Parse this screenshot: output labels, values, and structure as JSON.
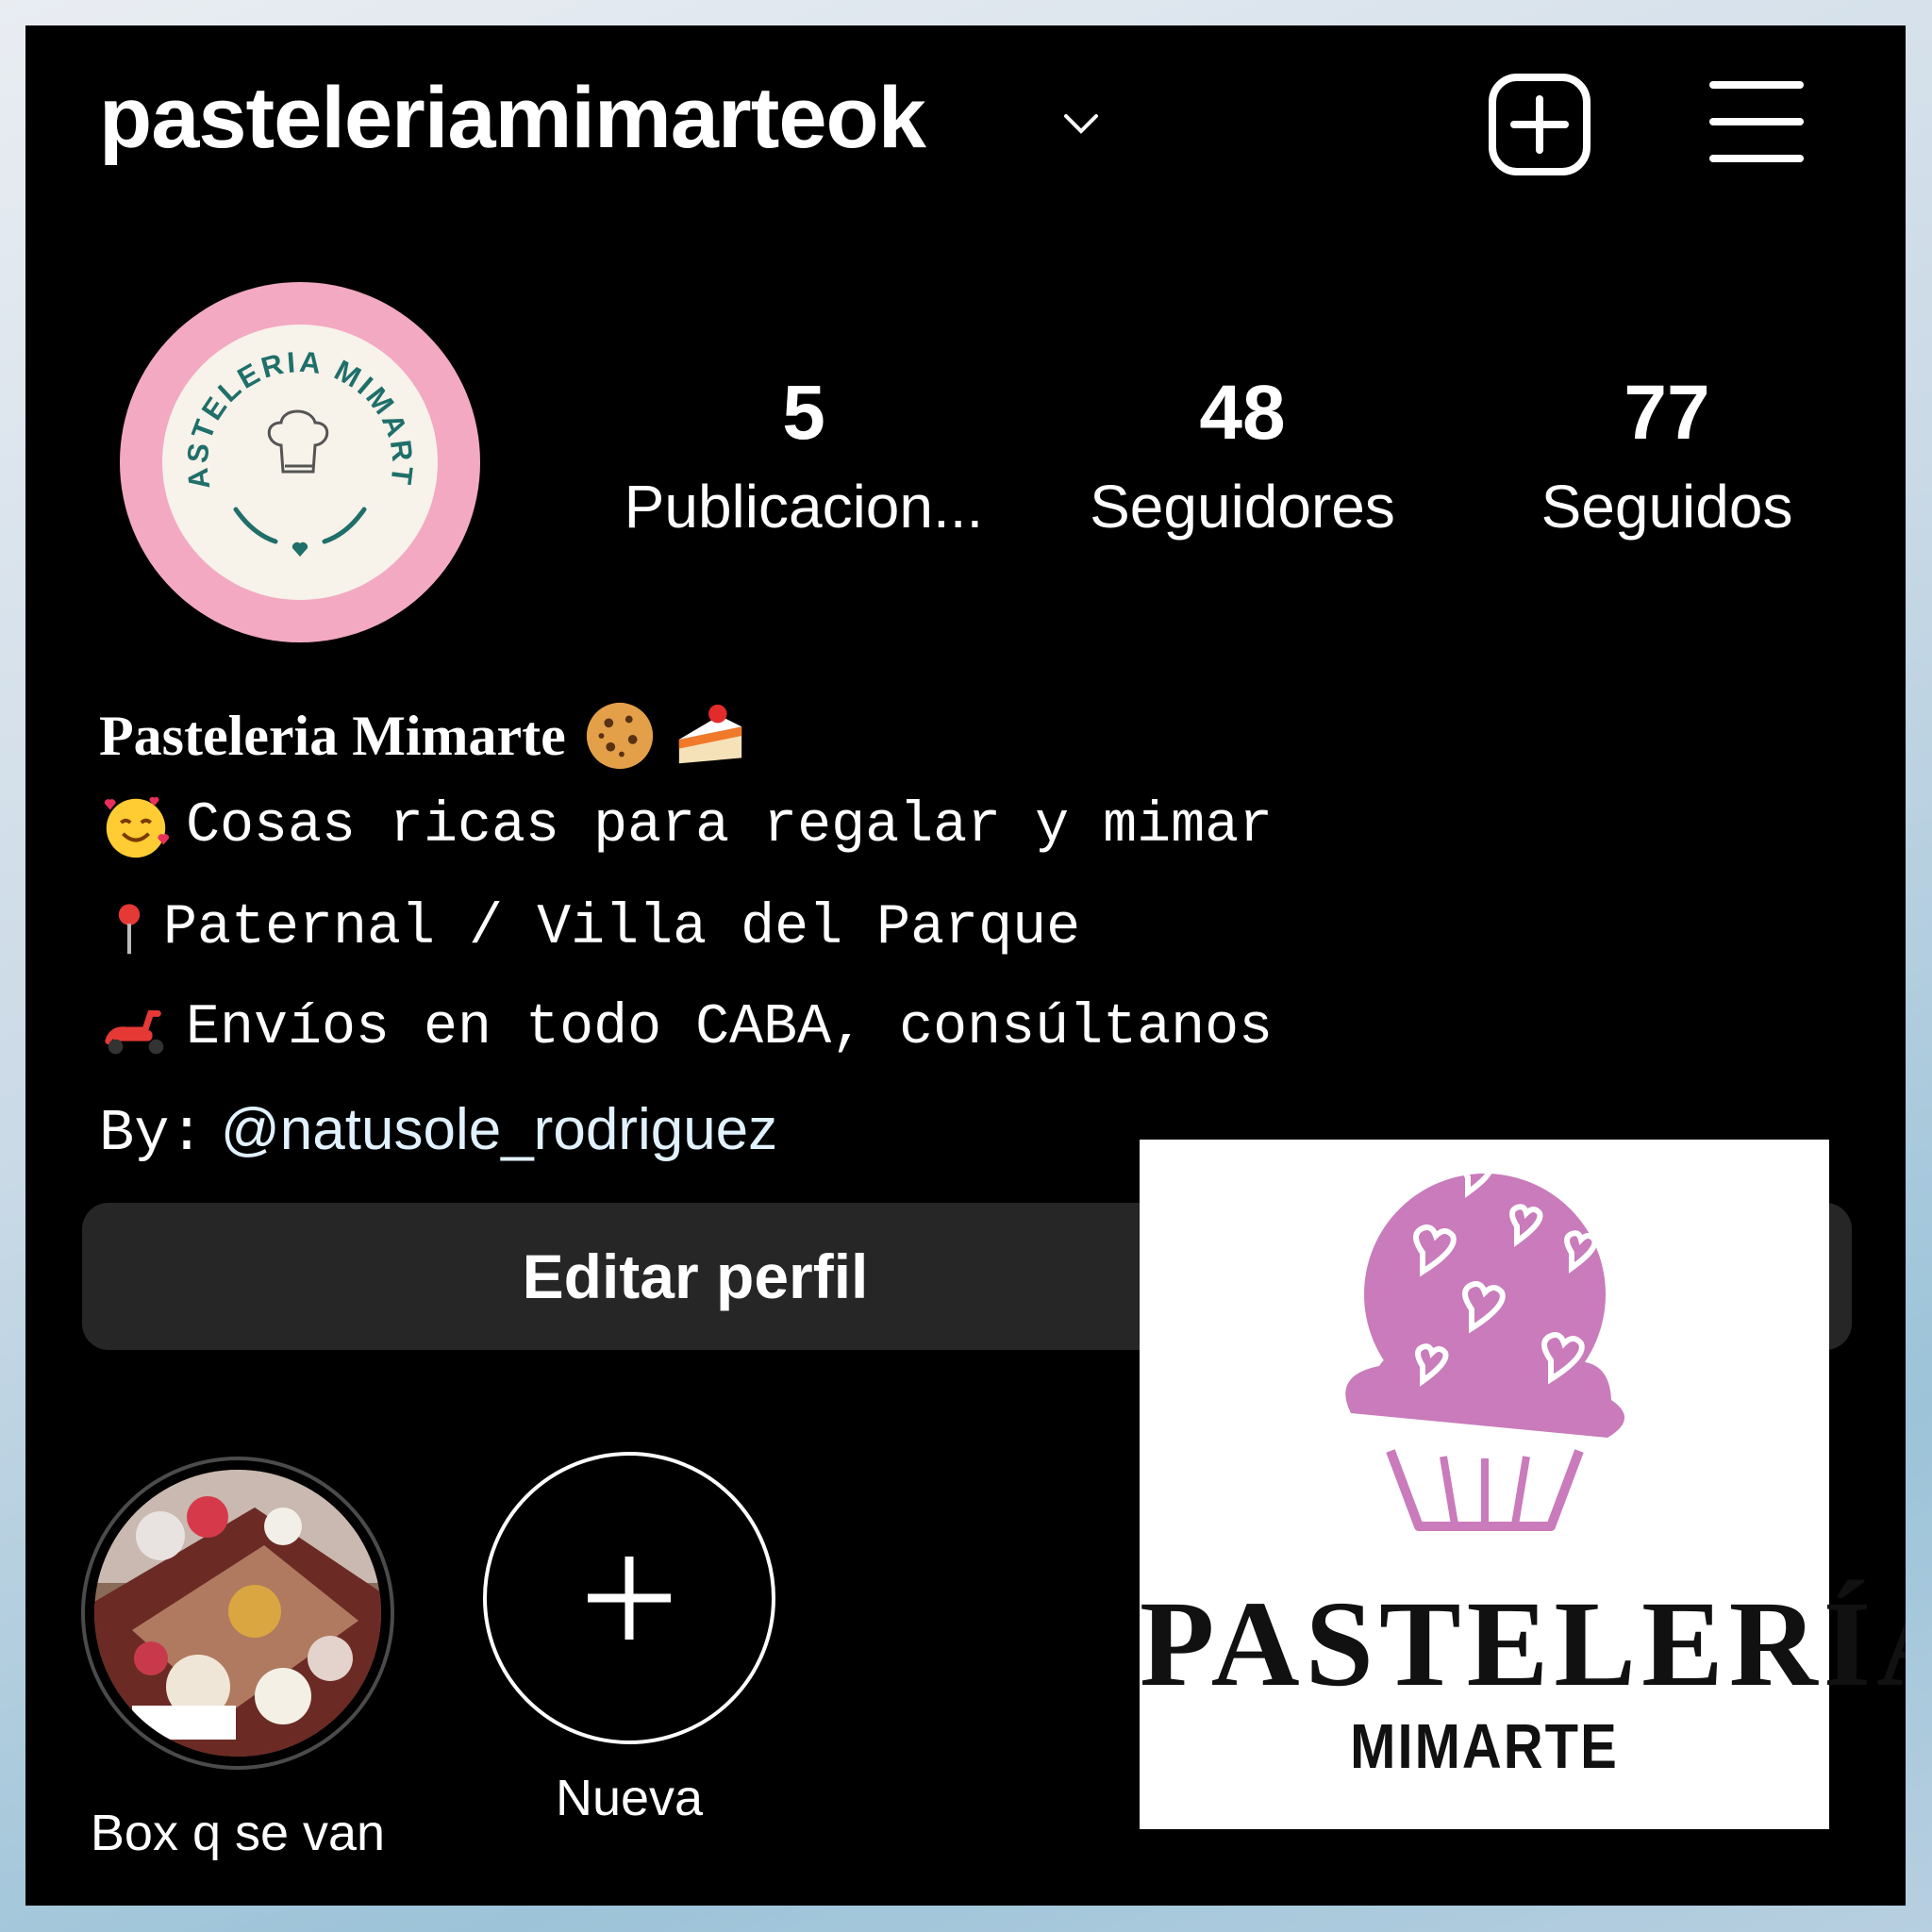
{
  "header": {
    "username": "pasteleriamimarteok"
  },
  "avatar": {
    "ring_text": "PASTELERIA MIMARTE",
    "colors": {
      "ring": "#f3a9c2",
      "inner": "#f7f2ea",
      "text": "#1f6f6a"
    }
  },
  "stats": [
    {
      "value": "5",
      "label": "Publicacion..."
    },
    {
      "value": "48",
      "label": "Seguidores"
    },
    {
      "value": "77",
      "label": "Seguidos"
    }
  ],
  "bio": {
    "name": "Pasteleria Mimarte",
    "name_emojis": [
      "cookie-icon",
      "cake-slice-icon"
    ],
    "lines": [
      {
        "icon": "smiling-hearts-face-icon",
        "text": "Cosas ricas para regalar y mimar"
      },
      {
        "icon": "pin-icon",
        "text": "Paternal / Villa del Parque"
      },
      {
        "icon": "scooter-icon",
        "text": "Envíos en todo CABA, consúltanos"
      }
    ],
    "by_prefix": "By:",
    "by_handle": "@natusole_rodriguez"
  },
  "buttons": {
    "edit_profile": "Editar perfil"
  },
  "highlights": [
    {
      "label": "Box q se van"
    },
    {
      "label": "Nueva"
    }
  ],
  "logo": {
    "word": "PASTELERÍA",
    "sub": "MIMARTE",
    "cupcake_color": "#c97bbb"
  }
}
